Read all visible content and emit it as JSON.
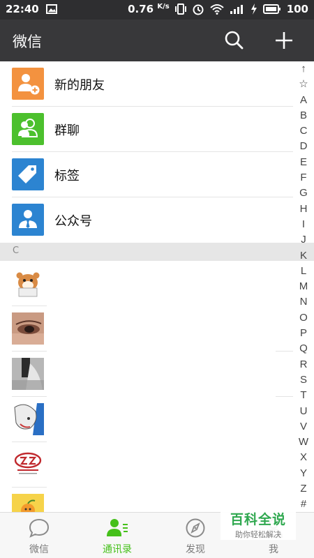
{
  "status_bar": {
    "time": "22:40",
    "speed": "0.76",
    "speed_unit": "K/s",
    "battery": "100"
  },
  "header": {
    "title": "微信"
  },
  "menu": [
    {
      "label": "新的朋友",
      "icon": "new-friend-icon",
      "color": "#f3923f"
    },
    {
      "label": "群聊",
      "icon": "group-chat-icon",
      "color": "#4cc02d"
    },
    {
      "label": "标签",
      "icon": "tag-icon",
      "color": "#2c84d1"
    },
    {
      "label": "公众号",
      "icon": "official-account-icon",
      "color": "#2c84d1"
    }
  ],
  "section": {
    "letter": "C"
  },
  "alphabet": [
    "↑",
    "☆",
    "A",
    "B",
    "C",
    "D",
    "E",
    "F",
    "G",
    "H",
    "I",
    "J",
    "K",
    "L",
    "M",
    "N",
    "O",
    "P",
    "Q",
    "R",
    "S",
    "T",
    "U",
    "V",
    "W",
    "X",
    "Y",
    "Z",
    "#"
  ],
  "tabs": [
    {
      "label": "微信",
      "icon": "chat-icon",
      "active": false
    },
    {
      "label": "通讯录",
      "icon": "contacts-icon",
      "active": true
    },
    {
      "label": "发现",
      "icon": "discover-icon",
      "active": false
    },
    {
      "label": "我",
      "icon": "me-icon",
      "active": false
    }
  ],
  "watermark": {
    "title": "百科全说",
    "subtitle": "助你轻松解决"
  },
  "colors": {
    "accent": "#45c01a",
    "header": "#38383a",
    "status_bar": "#2e2e30"
  }
}
